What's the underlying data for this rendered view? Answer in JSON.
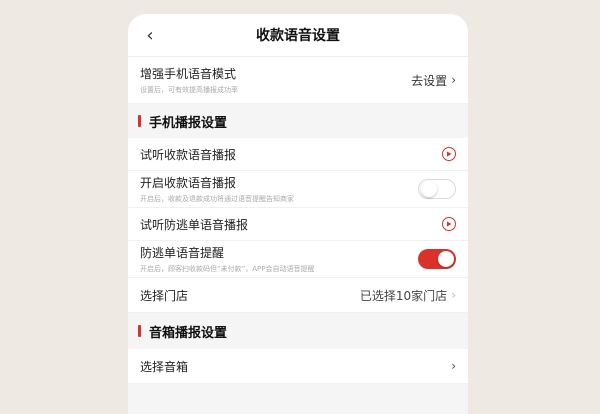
{
  "header": {
    "title": "收款语音设置",
    "back_icon": "chevron-left-icon"
  },
  "enhanced": {
    "label": "增强手机语音模式",
    "sub": "设置后，可有效提高播报成功率",
    "action": "去设置"
  },
  "phone_section": {
    "title": "手机播报设置",
    "items": [
      {
        "label": "试听收款语音播报",
        "sub": "",
        "control": "play"
      },
      {
        "label": "开启收款语音播报",
        "sub": "开启后，收款及退款成功将通过语音提醒告知商家",
        "control": "toggle",
        "on": false
      },
      {
        "label": "试听防逃单语音播报",
        "sub": "",
        "control": "play"
      },
      {
        "label": "防逃单语音提醒",
        "sub": "开启后，顾客扫收款码但“未付款”，APP会自动语音提醒",
        "control": "toggle",
        "on": true
      }
    ],
    "store": {
      "label": "选择门店",
      "value": "已选择10家门店"
    }
  },
  "speaker_section": {
    "title": "音箱播报设置",
    "select": {
      "label": "选择音箱"
    }
  },
  "colors": {
    "accent": "#d9322c",
    "background": "#f5f5f5"
  }
}
